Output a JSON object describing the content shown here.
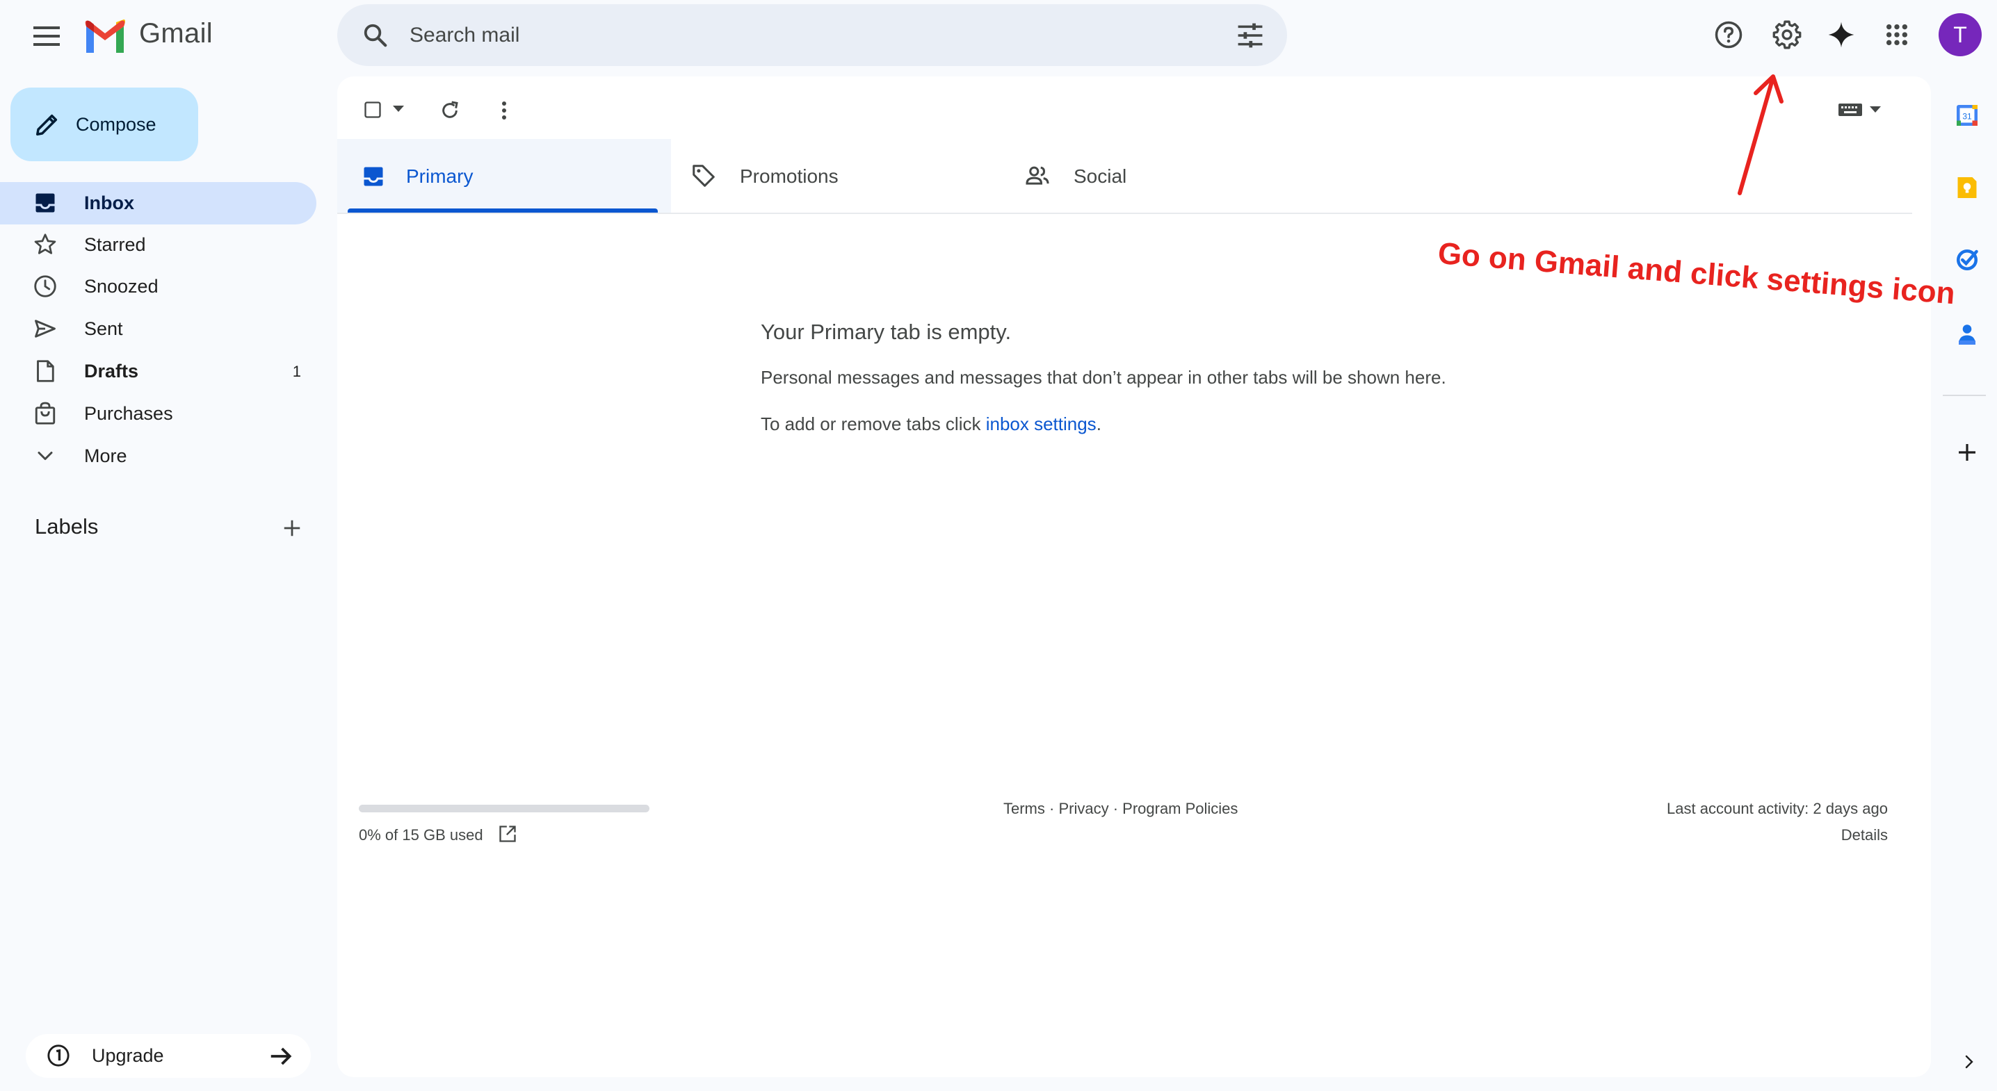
{
  "header": {
    "app_name": "Gmail",
    "search_placeholder": "Search mail",
    "account_initial": "T",
    "account_color": "#7627bb"
  },
  "sidebar": {
    "compose_label": "Compose",
    "items": [
      {
        "label": "Inbox",
        "icon": "inbox-icon",
        "active": true,
        "count": ""
      },
      {
        "label": "Starred",
        "icon": "star-icon",
        "active": false,
        "count": ""
      },
      {
        "label": "Snoozed",
        "icon": "clock-icon",
        "active": false,
        "count": ""
      },
      {
        "label": "Sent",
        "icon": "send-icon",
        "active": false,
        "count": ""
      },
      {
        "label": "Drafts",
        "icon": "draft-icon",
        "active": false,
        "count": "1"
      },
      {
        "label": "Purchases",
        "icon": "shopping-bag-icon",
        "active": false,
        "count": ""
      },
      {
        "label": "More",
        "icon": "chevron-down-icon",
        "active": false,
        "count": ""
      }
    ],
    "labels_heading": "Labels",
    "upgrade_label": "Upgrade"
  },
  "tabs": [
    {
      "label": "Primary",
      "icon": "inbox-icon",
      "active": true
    },
    {
      "label": "Promotions",
      "icon": "tag-icon",
      "active": false
    },
    {
      "label": "Social",
      "icon": "people-icon",
      "active": false
    }
  ],
  "main": {
    "empty_title": "Your Primary tab is empty.",
    "empty_description": "Personal messages and messages that don’t appear in other tabs will be shown here.",
    "empty_hint_prefix": "To add or remove tabs click ",
    "empty_hint_link": "inbox settings",
    "empty_hint_suffix": "."
  },
  "footer": {
    "storage_text": "0% of 15 GB used",
    "storage_used_fraction": 0,
    "links": [
      "Terms",
      "Privacy",
      "Program Policies"
    ],
    "separator": " · ",
    "last_activity": "Last account activity: 2 days ago",
    "details": "Details"
  },
  "annotation": {
    "text": "Go on Gmail and click settings icon",
    "color": "#e8231f"
  },
  "colors": {
    "accent": "#0b57d0",
    "compose_bg": "#c2e7ff",
    "active_nav_bg": "#d3e3fd",
    "page_bg": "#f8fafd"
  }
}
